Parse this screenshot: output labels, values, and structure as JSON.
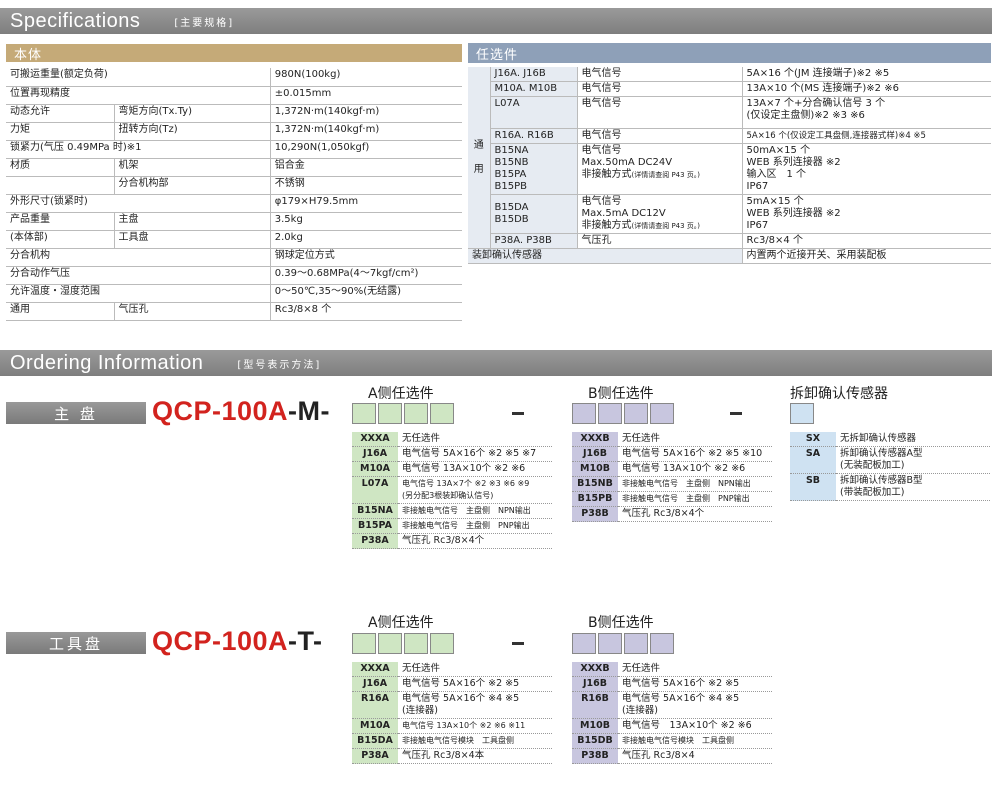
{
  "spec_header": {
    "en": "Specifications",
    "cn": "[主要规格]"
  },
  "body_title": "本体",
  "options_title": "任选件",
  "spec_rows": [
    {
      "a": "可搬运重量(额定负荷)",
      "b": "",
      "v": "980N(100kg)"
    },
    {
      "a": "位置再现精度",
      "b": "",
      "v": "±0.015mm"
    },
    {
      "a": "动态允许",
      "b": "弯矩方向(Tx.Ty)",
      "v": "1,372N·m(140kgf·m)"
    },
    {
      "a": "力矩",
      "b": "扭转方向(Tz)",
      "v": "1,372N·m(140kgf·m)"
    },
    {
      "a": "锁紧力(气压 0.49MPa 时)※1",
      "b": "",
      "v": "10,290N(1,050kgf)"
    },
    {
      "a": "材质",
      "b": "机架",
      "v": "铝合金"
    },
    {
      "a": "",
      "b": "分合机构部",
      "v": "不锈钢"
    },
    {
      "a": "外形尺寸(锁紧时)",
      "b": "",
      "v": "φ179×H79.5mm"
    },
    {
      "a": "产品重量",
      "b": "主盘",
      "v": "3.5kg"
    },
    {
      "a": "(本体部)",
      "b": "工具盘",
      "v": "2.0kg"
    },
    {
      "a": "分合机构",
      "b": "",
      "v": "钢球定位方式"
    },
    {
      "a": "分合动作气压",
      "b": "",
      "v": "0.39～0.68MPa(4～7kgf/cm²)"
    },
    {
      "a": "允许温度・湿度范围",
      "b": "",
      "v": "0～50℃,35～90%(无结露)"
    },
    {
      "a": "通用",
      "b": "气压孔",
      "v": "Rc3/8×8 个"
    }
  ],
  "opt_side_label": [
    "通",
    "用"
  ],
  "opt_rows": [
    {
      "name": "J16A. J16B",
      "type": "电气信号",
      "v": "5A×16 个(JM 连接端子)※2 ※5"
    },
    {
      "name": "M10A. M10B",
      "type": "电气信号",
      "v": "13A×10 个(MS 连接端子)※2 ※6"
    },
    {
      "name": "L07A",
      "type": "电气信号",
      "v": "13A×7 个+分合确认信号 3 个",
      "v2": "(仅设定主盘侧)※2 ※3 ※6"
    },
    {
      "name": "R16A. R16B",
      "type": "电气信号",
      "v": "5A×16 个(仅设定工具盘侧,连接器式样)※4 ※5"
    },
    {
      "names": [
        "B15NA",
        "B15NB",
        "B15PA",
        "B15PB"
      ],
      "type": "电气信号",
      "type2": "Max.50mA DC24V",
      "type3": "非接触方式",
      "type3s": "(详情请查阅 P43 页。)",
      "vals": [
        "50mA×15 个",
        "WEB 系列连接器 ※2",
        "输入区　1 个",
        "IP67"
      ]
    },
    {
      "names": [
        "B15DA",
        "B15DB"
      ],
      "type": "电气信号",
      "type2": "Max.5mA DC12V",
      "type3": "非接触方式",
      "type3s": "(详情请查阅 P43 页。)",
      "vals": [
        "5mA×15 个",
        "WEB 系列连接器 ※2",
        "IP67"
      ]
    },
    {
      "name": "P38A. P38B",
      "type": "气压孔",
      "v": "Rc3/8×4 个"
    }
  ],
  "opt_bottom": {
    "name": "装卸确认传感器",
    "v": "内置两个近接开关、采用装配板"
  },
  "order_header": {
    "en": "Ordering Information",
    "cn": "[型号表示方法]"
  },
  "master": {
    "label": "主 盘",
    "model": "QCP-100A",
    "suffix": "-M-",
    "a_title": "A侧任选件",
    "b_title": "B侧任选件",
    "s_title": "拆卸确认传感器",
    "a_opts": [
      {
        "c": "XXXA",
        "d": "无任选件"
      },
      {
        "c": "J16A",
        "d": "电气信号 5A×16个 ※2 ※5 ※7"
      },
      {
        "c": "M10A",
        "d": "电气信号 13A×10个 ※2 ※6"
      },
      {
        "c": "L07A",
        "d": "电气信号 13A×7个 ※2 ※3 ※6 ※9",
        "d2": "(另分配3根装卸确认信号)",
        "small": true
      },
      {
        "c": "B15NA",
        "d": "非接触电气信号　主盘侧　NPN输出",
        "small": true
      },
      {
        "c": "B15PA",
        "d": "非接触电气信号　主盘侧　PNP输出",
        "small": true
      },
      {
        "c": "P38A",
        "d": "气压孔 Rc3/8×4个"
      }
    ],
    "b_opts": [
      {
        "c": "XXXB",
        "d": "无任选件"
      },
      {
        "c": "J16B",
        "d": "电气信号 5A×16个 ※2 ※5 ※10"
      },
      {
        "c": "M10B",
        "d": "电气信号 13A×10个 ※2 ※6"
      },
      {
        "c": "B15NB",
        "d": "非接触电气信号　主盘侧　NPN输出",
        "small": true
      },
      {
        "c": "B15PB",
        "d": "非接触电气信号　主盘侧　PNP输出",
        "small": true
      },
      {
        "c": "P38B",
        "d": "气压孔 Rc3/8×4个"
      }
    ],
    "s_opts": [
      {
        "c": "SX",
        "d": "无拆卸确认传感器"
      },
      {
        "c": "SA",
        "d": "拆卸确认传感器A型",
        "d2": "(无装配板加工)"
      },
      {
        "c": "SB",
        "d": "拆卸确认传感器B型",
        "d2": "(带装配板加工)"
      }
    ]
  },
  "tool": {
    "label": "工具盘",
    "model": "QCP-100A",
    "suffix": "-T-",
    "a_title": "A侧任选件",
    "b_title": "B侧任选件",
    "a_opts": [
      {
        "c": "XXXA",
        "d": "无任选件"
      },
      {
        "c": "J16A",
        "d": "电气信号 5A×16个 ※2 ※5"
      },
      {
        "c": "R16A",
        "d": "电气信号 5A×16个 ※4 ※5",
        "d2": "(连接器)"
      },
      {
        "c": "M10A",
        "d": "电气信号 13A×10个 ※2 ※6 ※11",
        "small": true
      },
      {
        "c": "B15DA",
        "d": "非接触电气信号模块　工具盘侧",
        "small": true
      },
      {
        "c": "P38A",
        "d": "气压孔 Rc3/8×4本"
      }
    ],
    "b_opts": [
      {
        "c": "XXXB",
        "d": "无任选件"
      },
      {
        "c": "J16B",
        "d": "电气信号 5A×16个 ※2 ※5"
      },
      {
        "c": "R16B",
        "d": "电气信号 5A×16个 ※4 ※5",
        "d2": "(连接器)"
      },
      {
        "c": "M10B",
        "d": "电气信号　13A×10个 ※2 ※6"
      },
      {
        "c": "B15DB",
        "d": "非接触电气信号模块　工具盘侧",
        "small": true
      },
      {
        "c": "P38B",
        "d": "气压孔 Rc3/8×4"
      }
    ]
  }
}
